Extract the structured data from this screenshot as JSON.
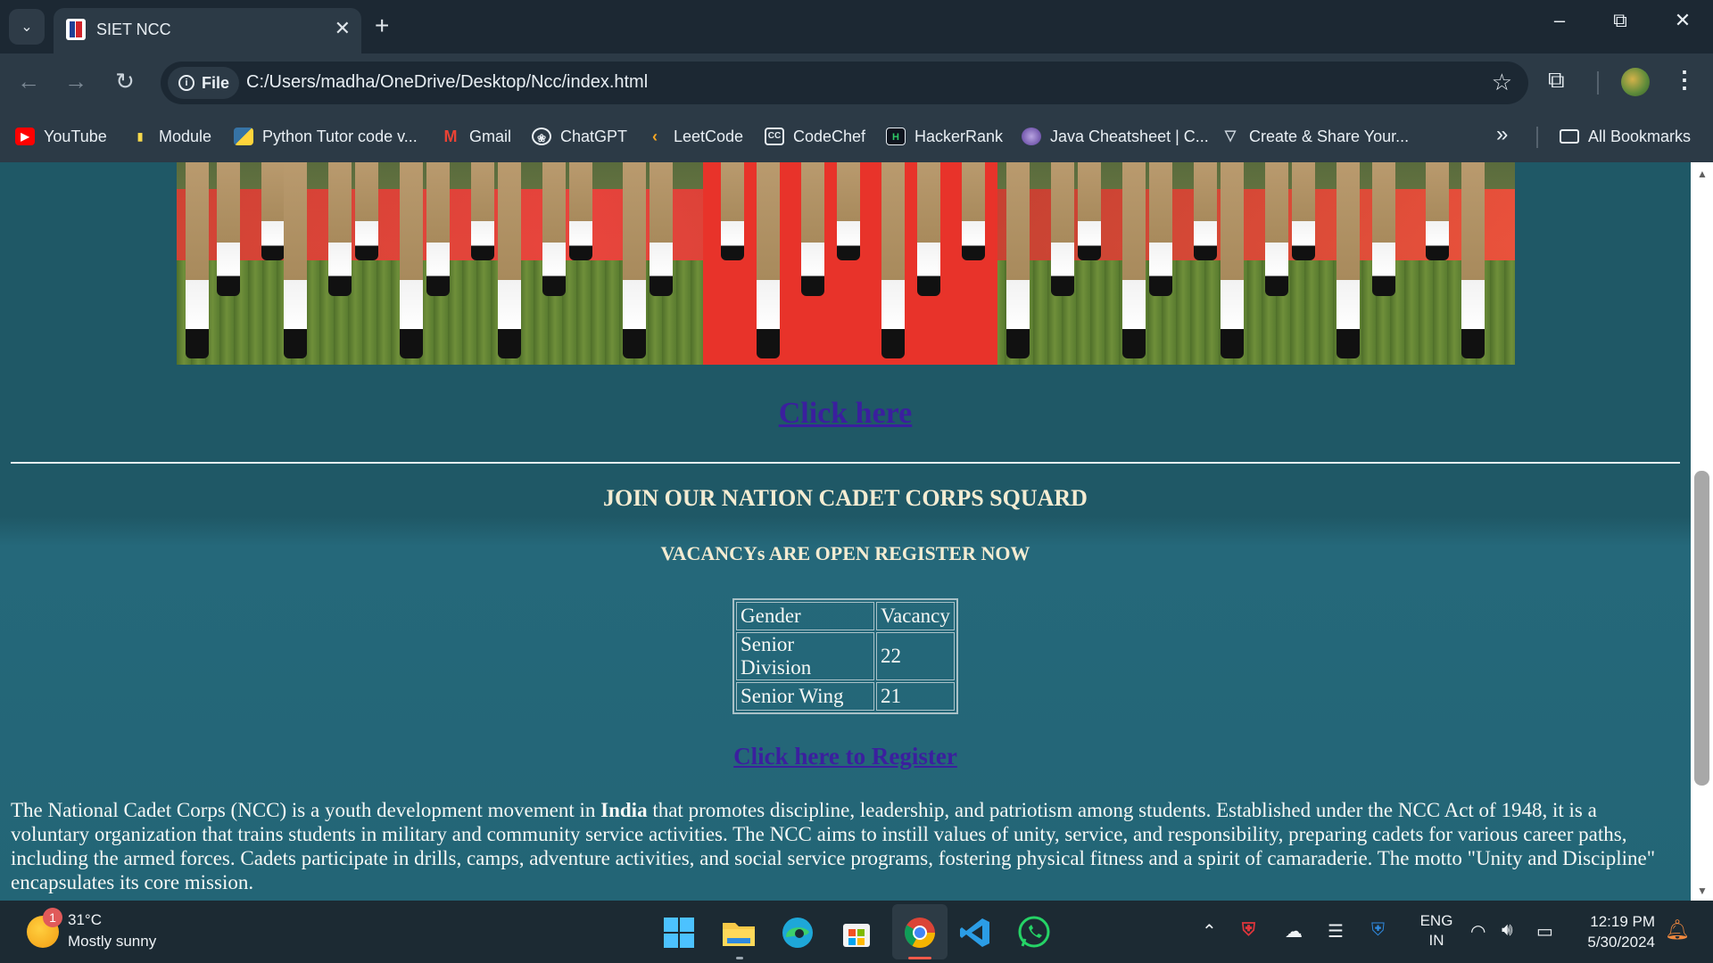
{
  "browser": {
    "tab_title": "SIET NCC",
    "new_tab": "+",
    "site_chip": "File",
    "url": "C:/Users/madha/OneDrive/Desktop/Ncc/index.html",
    "bookmarks": [
      {
        "label": "YouTube",
        "icon": "youtube-icon"
      },
      {
        "label": "Module",
        "icon": "module-icon"
      },
      {
        "label": "Python Tutor code v...",
        "icon": "python-icon"
      },
      {
        "label": "Gmail",
        "icon": "gmail-icon"
      },
      {
        "label": "ChatGPT",
        "icon": "chatgpt-icon"
      },
      {
        "label": "LeetCode",
        "icon": "leetcode-icon"
      },
      {
        "label": "CodeChef",
        "icon": "codechef-icon"
      },
      {
        "label": "HackerRank",
        "icon": "hackerrank-icon"
      },
      {
        "label": "Java Cheatsheet | C...",
        "icon": "java-cheatsheet-icon"
      },
      {
        "label": "Create & Share Your...",
        "icon": "create-share-icon"
      }
    ],
    "all_bookmarks": "All Bookmarks"
  },
  "page": {
    "click_here": "Click here",
    "heading": "JOIN OUR NATION CADET CORPS SQUARD",
    "subheading": "VACANCYs ARE OPEN REGISTER NOW",
    "table": {
      "headers": [
        "Gender",
        "Vacancy"
      ],
      "rows": [
        [
          "Senior Division",
          "22"
        ],
        [
          "Senior Wing",
          "21"
        ]
      ]
    },
    "register_link": "Click here to Register",
    "about": {
      "part1": "The National Cadet Corps (NCC) is a youth development movement in ",
      "bold": "India",
      "part2": " that promotes discipline, leadership, and patriotism among students. Established under the NCC Act of 1948, it is a voluntary organization that trains students in military and community service activities. The NCC aims to instill values of unity, service, and responsibility, preparing cadets for various career paths, including the armed forces. Cadets participate in drills, camps, adventure activities, and social service programs, fostering physical fitness and a spirit of camaraderie. The motto \"Unity and Discipline\" encapsulates its core mission."
    }
  },
  "taskbar": {
    "weather_badge": "1",
    "temperature": "31°C",
    "weather": "Mostly sunny",
    "lang_1": "ENG",
    "lang_2": "IN",
    "time": "12:19 PM",
    "date": "5/30/2024"
  },
  "colors": {
    "page_bg": "#1f5866",
    "link": "#3b1f9e",
    "heading": "#f4ecd2",
    "text": "#f6f8f5"
  }
}
